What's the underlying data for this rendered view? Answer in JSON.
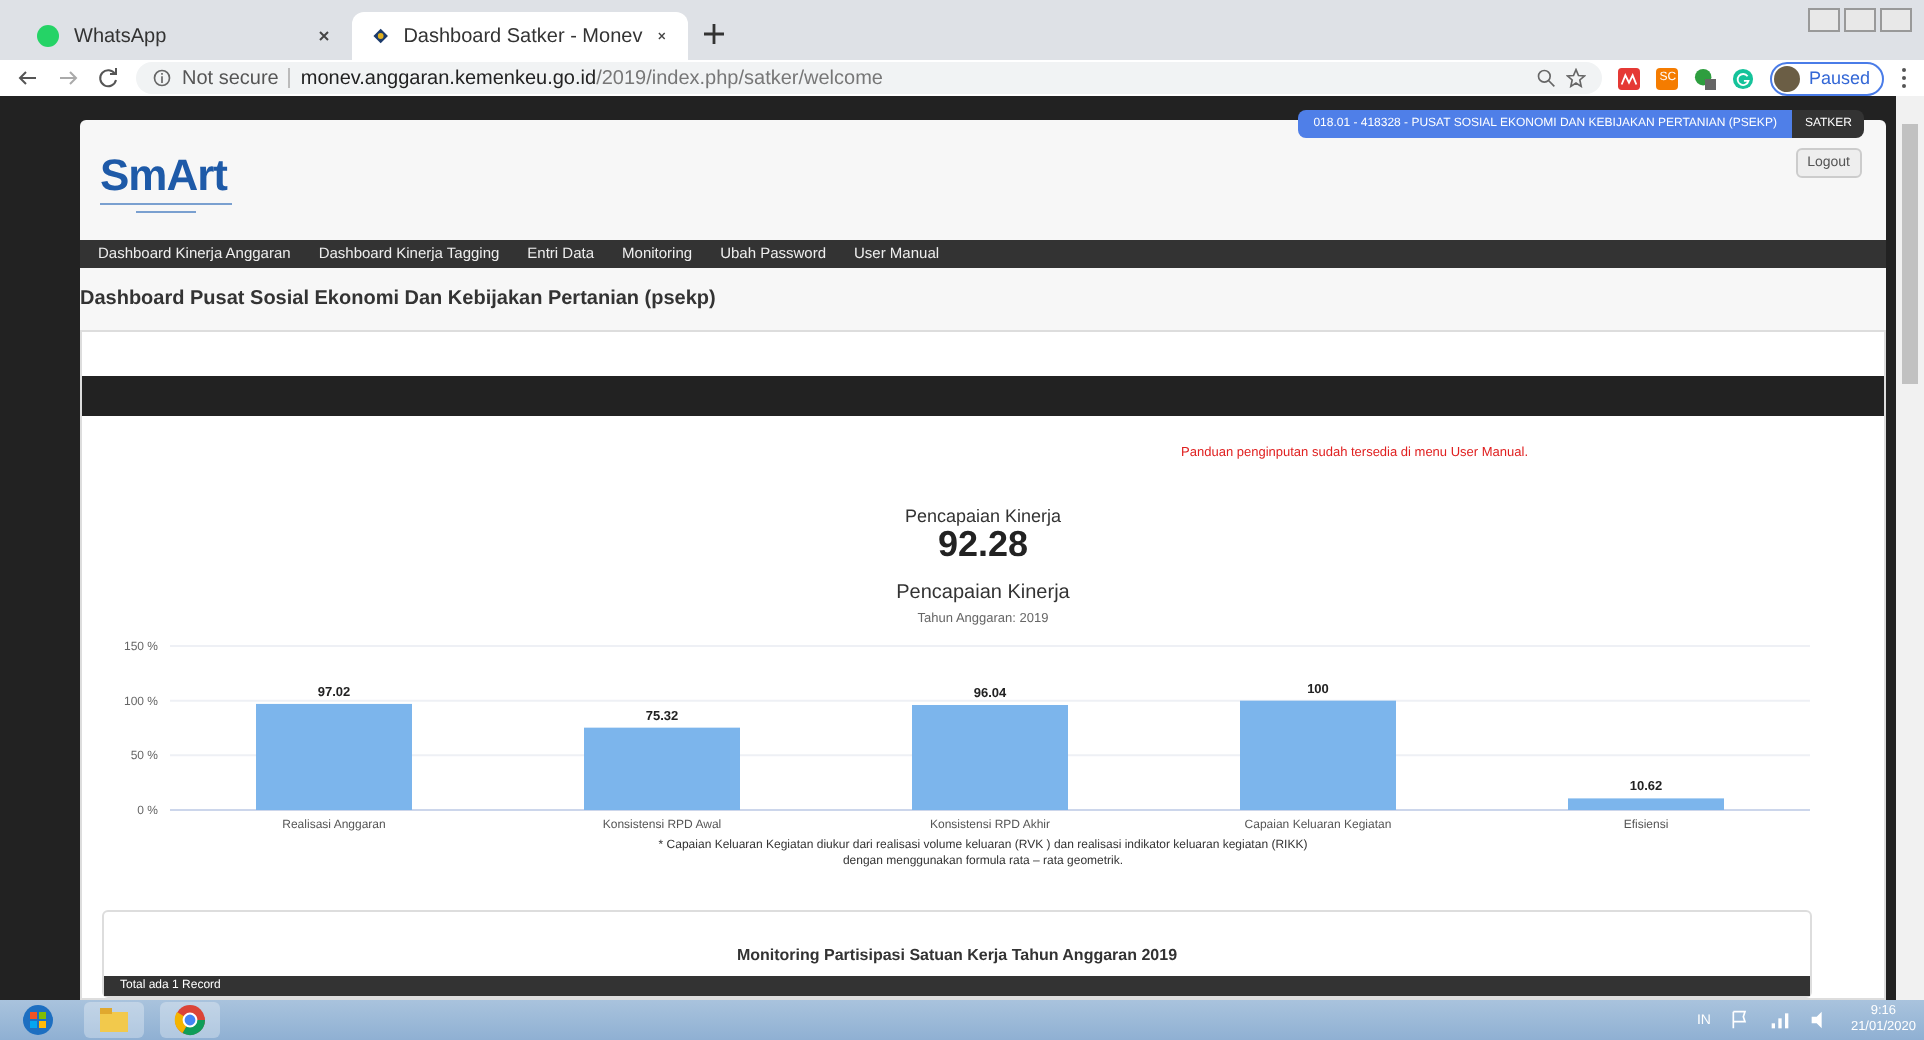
{
  "browser": {
    "tabs": [
      {
        "title": "WhatsApp",
        "selected": false
      },
      {
        "title": "Dashboard Satker - Monev",
        "selected": true
      }
    ],
    "security": "Not secure",
    "url_host": "monev.anggaran.kemenkeu.go.id",
    "url_path": "/2019/index.php/satker/welcome",
    "extension_label": "SC",
    "profile": "Paused"
  },
  "page": {
    "satker_badge": "018.01 - 418328 - PUSAT SOSIAL EKONOMI DAN KEBIJAKAN PERTANIAN (PSEKP)",
    "role_badge": "SATKER",
    "logout": "Logout",
    "logo": "SmArt",
    "nav": [
      "Dashboard Kinerja Anggaran",
      "Dashboard Kinerja Tagging",
      "Entri Data",
      "Monitoring",
      "Ubah Password",
      "User Manual"
    ],
    "heading": "Dashboard Pusat Sosial Ekonomi Dan Kebijakan Pertanian (psekp)",
    "notice": "Panduan penginputan sudah tersedia di menu User Manual.",
    "score_label": "Pencapaian Kinerja",
    "score": "92.28",
    "chart_data": {
      "type": "bar",
      "title": "Pencapaian Kinerja",
      "subtitle": "Tahun Anggaran: 2019",
      "categories": [
        "Realisasi Anggaran",
        "Konsistensi RPD Awal",
        "Konsistensi RPD Akhir",
        "Capaian Keluaran Kegiatan",
        "Efisiensi"
      ],
      "series": [
        {
          "color": "#7cb5ec",
          "values": [
            97.02,
            75.32,
            96.04,
            100,
            10.62
          ]
        }
      ],
      "ylim": [
        0,
        150
      ],
      "yticks": [
        {
          "value": 0,
          "label": "0 %"
        },
        {
          "value": 50,
          "label": "50 %"
        },
        {
          "value": 100,
          "label": "100 %"
        },
        {
          "value": 150,
          "label": "150 %"
        }
      ],
      "data_labels": true
    },
    "footnote": [
      "* Capaian Keluaran Kegiatan diukur dari realisasi volume keluaran (RVK ) dan realisasi indikator keluaran kegiatan (RIKK)",
      "dengan menggunakan formula rata – rata geometrik."
    ],
    "monitoring_title": "Monitoring Partisipasi Satuan Kerja Tahun Anggaran 2019",
    "record_count": "Total ada 1 Record"
  },
  "taskbar": {
    "language": "IN",
    "time": "9:16",
    "date": "21/01/2020"
  }
}
